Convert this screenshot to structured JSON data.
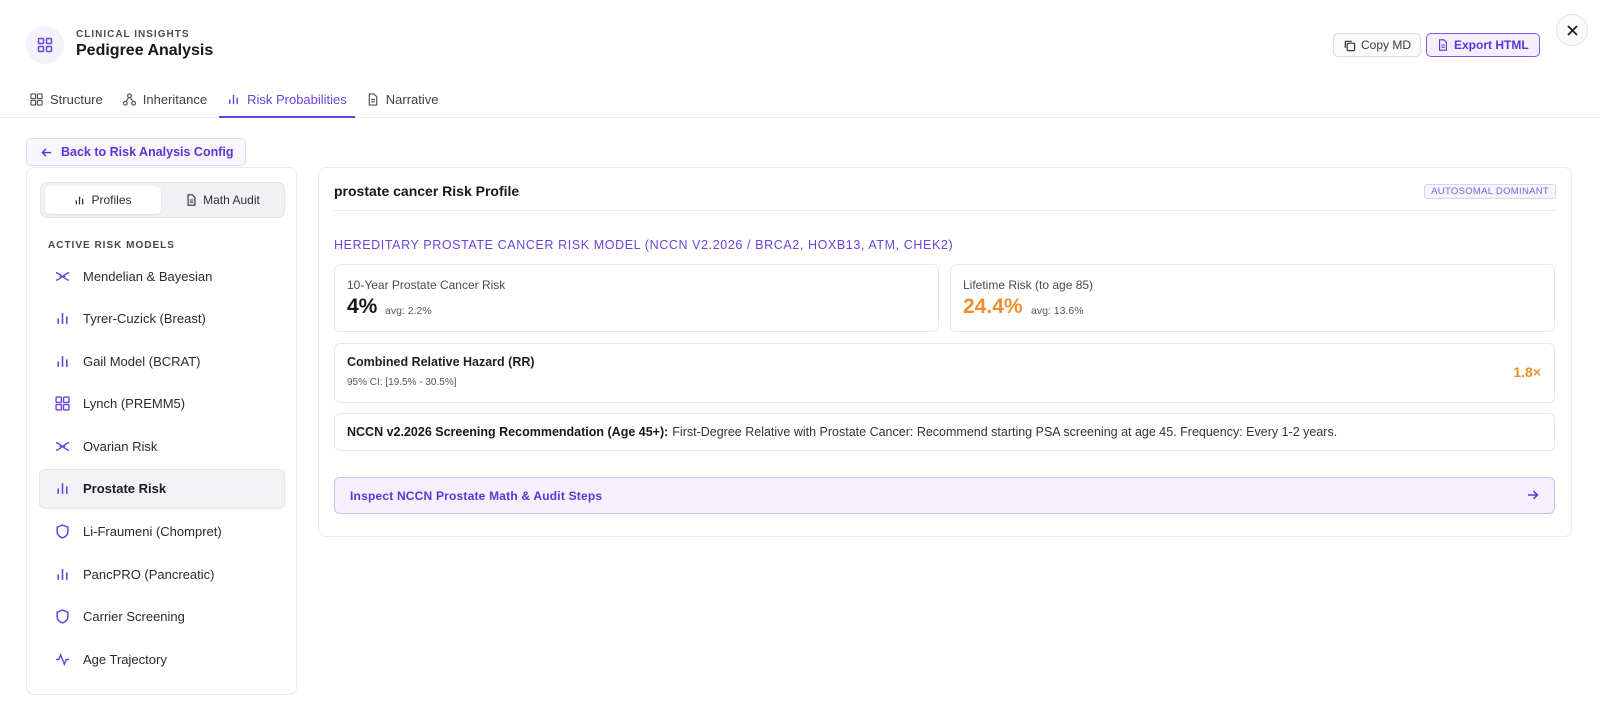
{
  "header": {
    "eyebrow": "CLINICAL INSIGHTS",
    "title": "Pedigree Analysis",
    "copy_label": "Copy MD",
    "export_label": "Export HTML"
  },
  "tabs": [
    {
      "label": "Structure",
      "icon": "grid-icon"
    },
    {
      "label": "Inheritance",
      "icon": "network-icon"
    },
    {
      "label": "Risk Probabilities",
      "icon": "bar-chart-icon",
      "active": true
    },
    {
      "label": "Narrative",
      "icon": "document-icon"
    }
  ],
  "back_label": "Back to Risk Analysis Config",
  "sidebar": {
    "segments": [
      "Profiles",
      "Math Audit"
    ],
    "section_label": "ACTIVE RISK MODELS",
    "items": [
      {
        "label": "Mendelian & Bayesian",
        "icon": "dna-icon"
      },
      {
        "label": "Tyrer-Cuzick (Breast)",
        "icon": "bar-chart-icon"
      },
      {
        "label": "Gail Model (BCRAT)",
        "icon": "bar-chart-icon"
      },
      {
        "label": "Lynch (PREMM5)",
        "icon": "grid-icon"
      },
      {
        "label": "Ovarian Risk",
        "icon": "dna-icon"
      },
      {
        "label": "Prostate Risk",
        "icon": "bar-chart-icon",
        "active": true
      },
      {
        "label": "Li-Fraumeni (Chompret)",
        "icon": "shield-icon"
      },
      {
        "label": "PancPRO (Pancreatic)",
        "icon": "bar-chart-icon"
      },
      {
        "label": "Carrier Screening",
        "icon": "shield-icon"
      },
      {
        "label": "Age Trajectory",
        "icon": "activity-icon"
      }
    ]
  },
  "main": {
    "title": "prostate cancer Risk Profile",
    "pattern": "AUTOSOMAL DOMINANT",
    "model_heading": "HEREDITARY PROSTATE CANCER RISK MODEL (NCCN V2.2026 / BRCA2, HOXB13, ATM, CHEK2)",
    "ten_year": {
      "label": "10-Year Prostate Cancer Risk",
      "value": "4%",
      "avg": "avg: 2.2%"
    },
    "lifetime": {
      "label": "Lifetime Risk (to age 85)",
      "value": "24.4%",
      "avg": "avg: 13.6%"
    },
    "hazard": {
      "label": "Combined Relative Hazard (RR)",
      "ci": "95% CI: [19.5% - 30.5%]",
      "value": "1.8×"
    },
    "nccn": {
      "label": "NCCN v2.2026 Screening Recommendation (Age 45+):",
      "text": "First-Degree Relative with Prostate Cancer: Recommend starting PSA screening at age 45. Frequency: Every 1-2 years."
    },
    "inspect_label": "Inspect NCCN Prostate Math & Audit Steps"
  },
  "colors": {
    "accent": "#6a44db",
    "highlight": "#ef8f2c"
  }
}
